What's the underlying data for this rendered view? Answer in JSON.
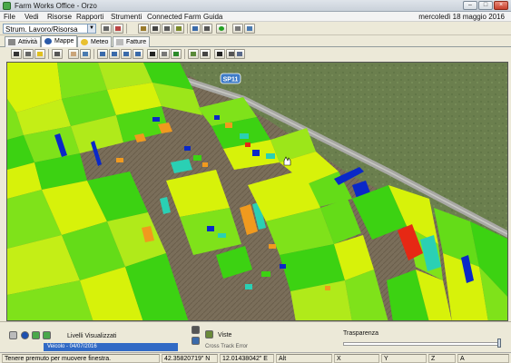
{
  "window": {
    "title": "Farm Works Office - Orzo",
    "buttons": [
      "minimize",
      "maximize",
      "close"
    ]
  },
  "menu": {
    "items": [
      "File",
      "Vedi",
      "Risorse",
      "Rapporti",
      "Strumenti",
      "Connected Farm",
      "Guida"
    ],
    "date": "mercoledì 18 maggio 2016"
  },
  "toolbar": {
    "combo_value": "Strum. Lavoro/Risorsa"
  },
  "tabs": [
    {
      "label": "Attività",
      "icon": "activity-icon",
      "active": false
    },
    {
      "label": "Mappe",
      "icon": "globe-icon",
      "active": true
    },
    {
      "label": "Meteo",
      "icon": "weather-icon",
      "active": false
    },
    {
      "label": "Fatture",
      "icon": "invoice-icon",
      "active": false
    }
  ],
  "map": {
    "road_label": "SP11"
  },
  "bottom": {
    "layers_label": "Livelli Visualizzati",
    "selected_layer": "Veicolo - 04/07/2016",
    "views_label": "Viste",
    "views_item": "Cross Track Error",
    "transparency_label": "Trasparenza"
  },
  "status": {
    "hint": "Tenere premuto per muovere finestra.",
    "lat": "42.35820719\" N",
    "lon": "12.01438042\" E",
    "alt_label": "Alt",
    "x_label": "X",
    "y_label": "Y",
    "z_label": "Z",
    "a_label": "A"
  },
  "colors": {
    "field_green": "#7fe21a",
    "field_yellow": "#d7f20a",
    "field_lime": "#3cd212",
    "field_blue": "#0a28c8",
    "field_orange": "#f09a1e",
    "field_red": "#e62814",
    "road": "#9a9a98",
    "grass": "#6e8a4e"
  }
}
